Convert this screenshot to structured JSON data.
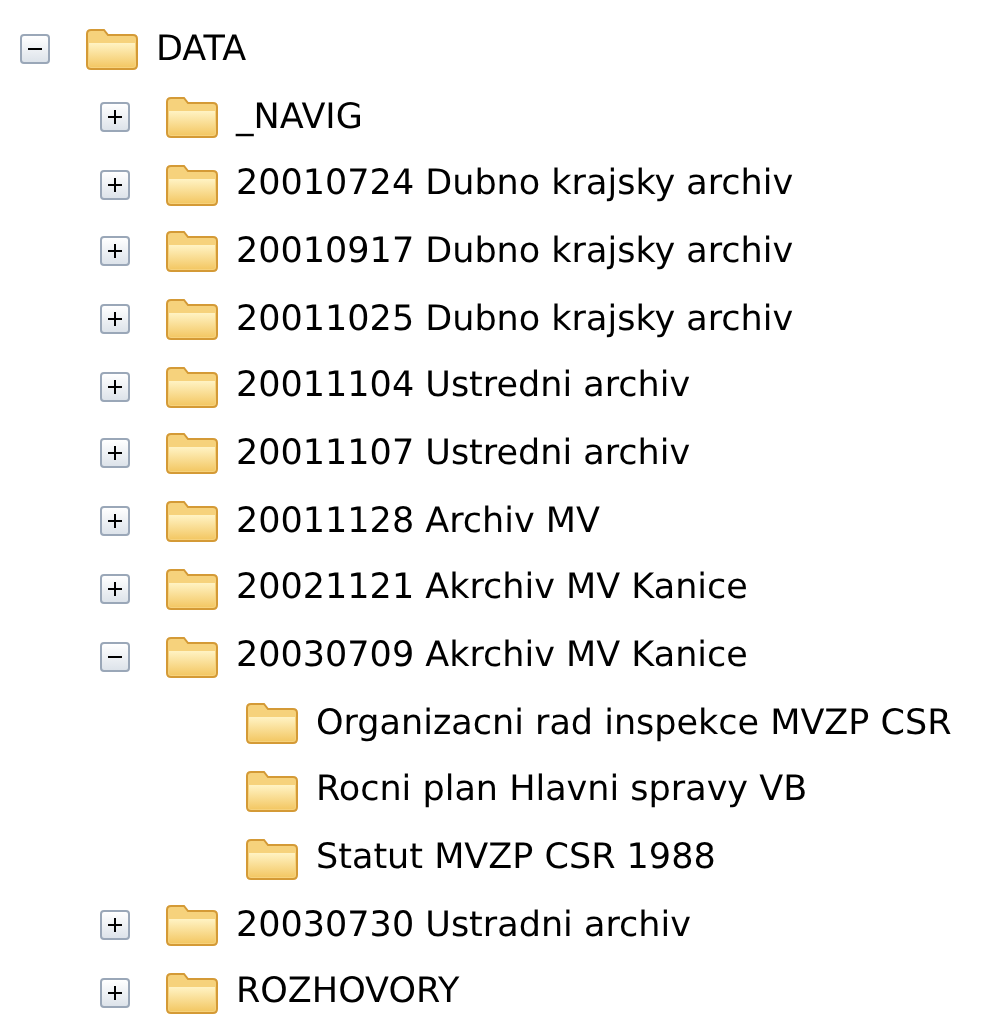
{
  "tree": [
    {
      "label": "DATA",
      "expanded": true,
      "children": [
        {
          "label": "_NAVIG",
          "expanded": false
        },
        {
          "label": "20010724 Dubno krajsky archiv",
          "expanded": false
        },
        {
          "label": "20010917 Dubno krajsky archiv",
          "expanded": false
        },
        {
          "label": "20011025 Dubno krajsky archiv",
          "expanded": false
        },
        {
          "label": "20011104 Ustredni archiv",
          "expanded": false
        },
        {
          "label": "20011107 Ustredni archiv",
          "expanded": false
        },
        {
          "label": "20011128 Archiv MV",
          "expanded": false
        },
        {
          "label": "20021121 Akrchiv MV Kanice",
          "expanded": false
        },
        {
          "label": "20030709 Akrchiv MV Kanice",
          "expanded": true,
          "children": [
            {
              "label": "Organizacni rad inspekce MVZP CSR"
            },
            {
              "label": "Rocni plan Hlavni spravy VB"
            },
            {
              "label": "Statut MVZP CSR 1988"
            }
          ]
        },
        {
          "label": "20030730 Ustradni archiv",
          "expanded": false
        },
        {
          "label": "ROZHOVORY",
          "expanded": false
        }
      ]
    }
  ]
}
